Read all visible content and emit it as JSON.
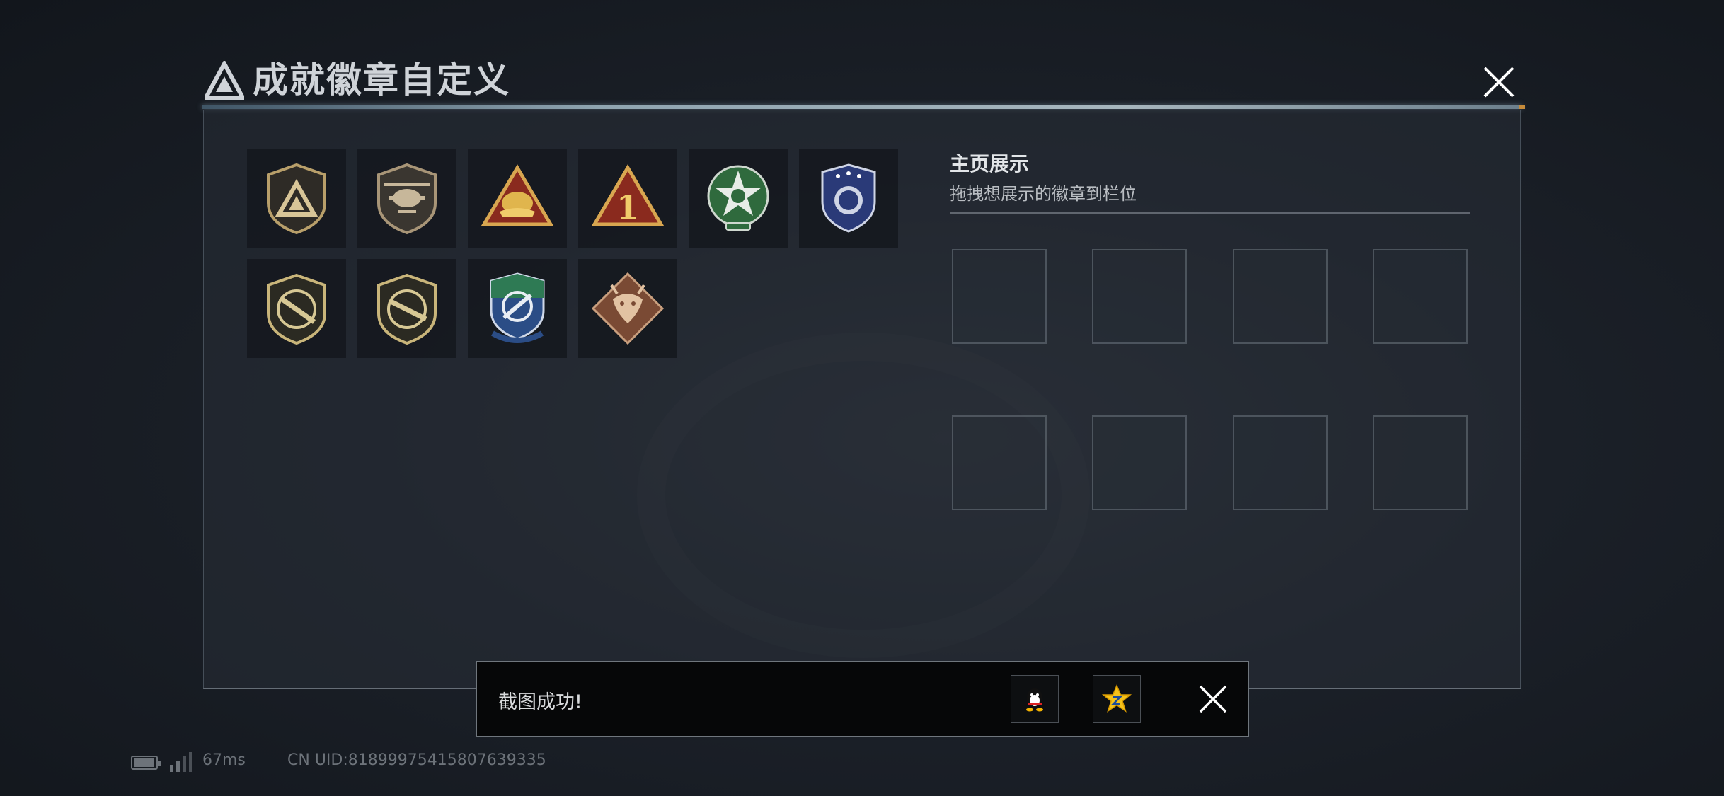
{
  "header": {
    "title": "成就徽章自定义"
  },
  "badges": [
    {
      "name": "triangle-logo-badge"
    },
    {
      "name": "helicopter-badge"
    },
    {
      "name": "gold-helmet-badge"
    },
    {
      "name": "number-one-badge"
    },
    {
      "name": "green-star-badge"
    },
    {
      "name": "blue-shield-badge"
    },
    {
      "name": "rifle-badge-1"
    },
    {
      "name": "rifle-badge-2"
    },
    {
      "name": "blue-crosshair-badge"
    },
    {
      "name": "dragon-badge"
    }
  ],
  "showcase": {
    "title": "主页展示",
    "subtitle": "拖拽想展示的徽章到栏位",
    "slot_count": 8
  },
  "toast": {
    "message": "截图成功!"
  },
  "status": {
    "ping": "67ms",
    "uid": "CN UID:8189997541580763933​5"
  },
  "colors": {
    "panel_bg": "#282e36",
    "accent_line": "#a7b6be",
    "accent_orange": "#c58a3a"
  }
}
